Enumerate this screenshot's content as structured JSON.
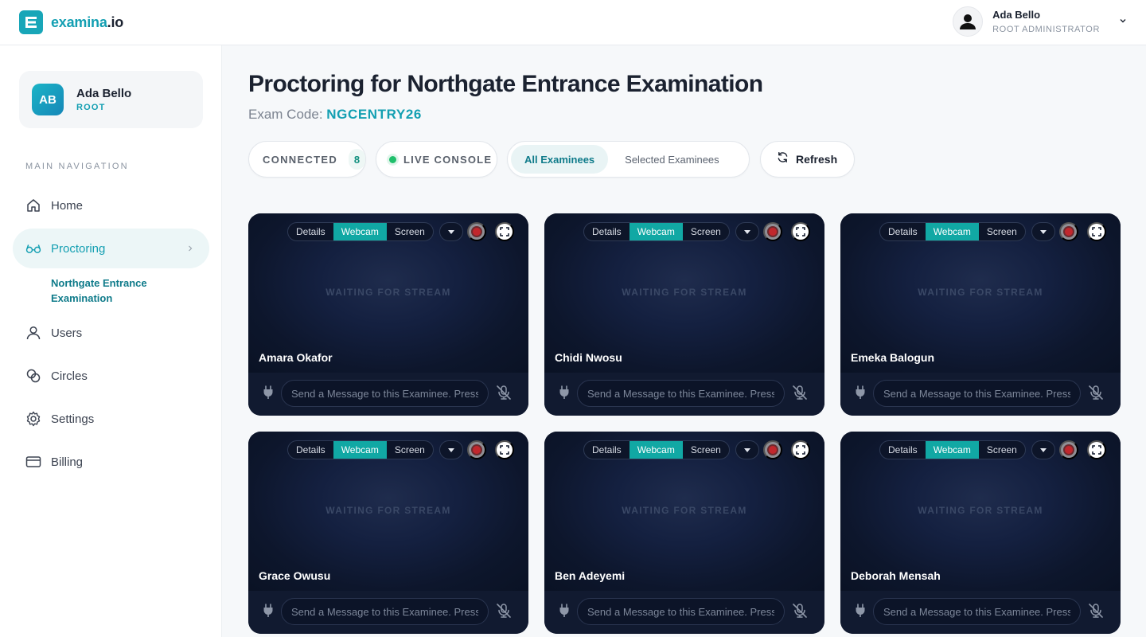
{
  "brand": {
    "name": "examina",
    "suffix": ".io"
  },
  "user_menu": {
    "name": "Ada Bello",
    "role": "ROOT ADMINISTRATOR"
  },
  "sidebar": {
    "profile": {
      "initials": "AB",
      "name": "Ada Bello",
      "role": "ROOT"
    },
    "nav_heading": "MAIN NAVIGATION",
    "items": [
      {
        "label": "Home",
        "icon": "home-icon"
      },
      {
        "label": "Proctoring",
        "icon": "glasses-icon",
        "active": true,
        "subitem": "Northgate Entrance Examination"
      },
      {
        "label": "Users",
        "icon": "user-icon"
      },
      {
        "label": "Circles",
        "icon": "circles-icon"
      },
      {
        "label": "Settings",
        "icon": "gear-icon"
      },
      {
        "label": "Billing",
        "icon": "credit-card-icon"
      }
    ]
  },
  "main": {
    "title": "Proctoring for Northgate Entrance Examination",
    "exam_code_label": "Exam Code:",
    "exam_code": "NGCENTRY26",
    "connected_label": "CONNECTED",
    "connected_count": "8",
    "live_label": "LIVE CONSOLE",
    "filter": {
      "all": "All Examinees",
      "selected": "Selected Examinees",
      "active": "all"
    },
    "refresh_label": "Refresh"
  },
  "card_common": {
    "tabs": [
      "Details",
      "Webcam",
      "Screen"
    ],
    "active_tab": "Webcam",
    "waiting_text": "WAITING FOR STREAM",
    "message_placeholder": "Send a Message to this Examinee. Press Enter to send"
  },
  "examinees": [
    {
      "name": "Amara Okafor"
    },
    {
      "name": "Chidi Nwosu"
    },
    {
      "name": "Emeka Balogun"
    },
    {
      "name": "Grace Owusu"
    },
    {
      "name": "Ben Adeyemi"
    },
    {
      "name": "Deborah Mensah"
    }
  ],
  "colors": {
    "accent": "#139fb2",
    "active_tab": "#11a8a4",
    "card_bg": "#0b1326",
    "live": "#1fbf6b"
  }
}
